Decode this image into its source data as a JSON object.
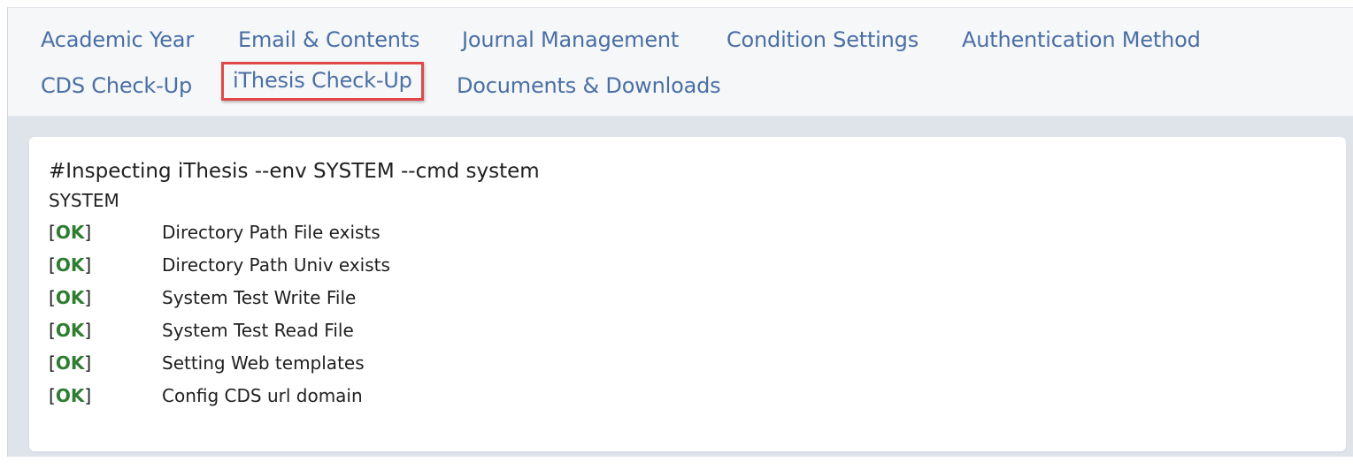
{
  "nav": {
    "links": [
      {
        "label": "Academic Year"
      },
      {
        "label": "Email & Contents"
      },
      {
        "label": "Journal Management"
      },
      {
        "label": "Condition Settings"
      },
      {
        "label": "Authentication Method"
      },
      {
        "label": "CDS Check-Up"
      },
      {
        "label": "iThesis Check-Up"
      },
      {
        "label": "Documents & Downloads"
      }
    ],
    "active_index": 6,
    "highlight_color": "#e04848",
    "link_color": "#4a6fa5"
  },
  "console": {
    "command": "#Inspecting iThesis --env SYSTEM --cmd system",
    "section": "SYSTEM",
    "status_color": "#2e7d32",
    "checks": [
      {
        "status": "OK",
        "text": "Directory Path File exists"
      },
      {
        "status": "OK",
        "text": "Directory Path Univ exists"
      },
      {
        "status": "OK",
        "text": "System Test Write File"
      },
      {
        "status": "OK",
        "text": "System Test Read File"
      },
      {
        "status": "OK",
        "text": "Setting Web templates"
      },
      {
        "status": "OK",
        "text": "Config CDS url domain"
      }
    ]
  }
}
